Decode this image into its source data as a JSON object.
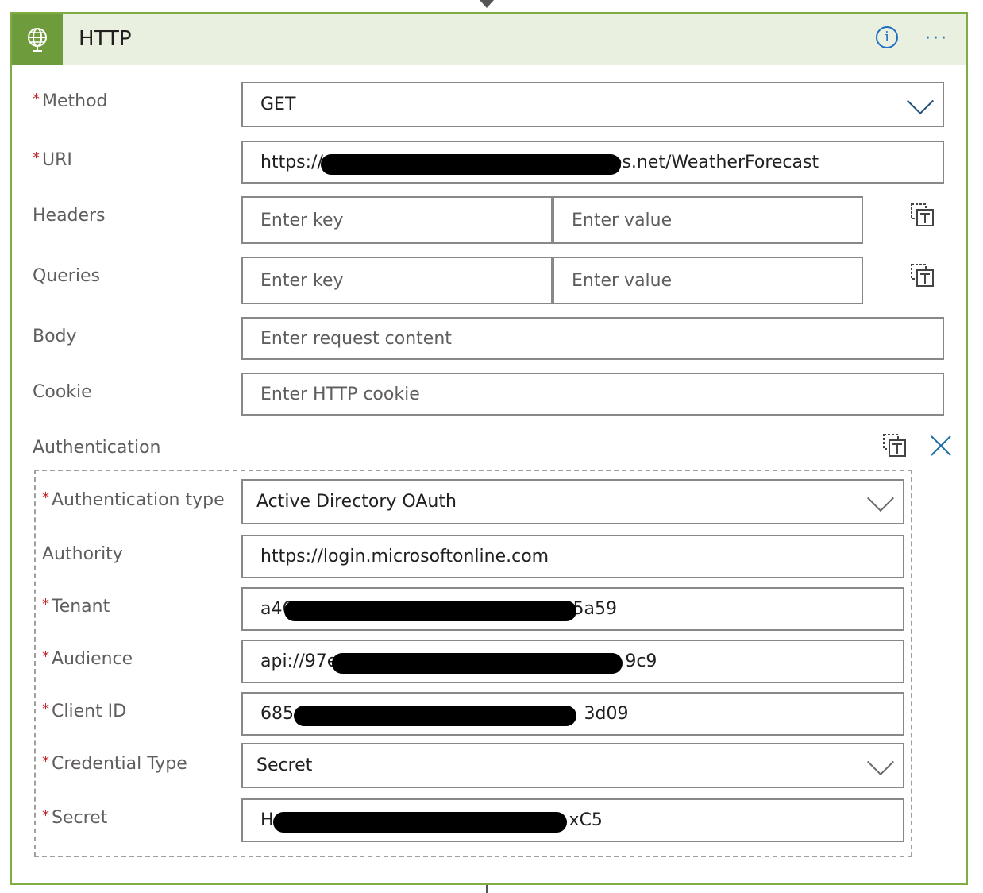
{
  "card": {
    "title": "HTTP",
    "info_label": "i",
    "more_label": "···"
  },
  "colors": {
    "accent_border": "#7fad43",
    "header_bg": "#e9f0e0",
    "icon_bg": "#6e9b3c",
    "link_blue": "#1f6fc5",
    "required_red": "#c4262e"
  },
  "required_marker": "*",
  "fields": {
    "method": {
      "label": "Method",
      "value": "GET"
    },
    "uri": {
      "label": "URI",
      "value_start": "https://",
      "value_end": "es.net/WeatherForecast"
    },
    "headers": {
      "label": "Headers",
      "key_placeholder": "Enter key",
      "value_placeholder": "Enter value"
    },
    "queries": {
      "label": "Queries",
      "key_placeholder": "Enter key",
      "value_placeholder": "Enter value"
    },
    "body": {
      "label": "Body",
      "placeholder": "Enter request content"
    },
    "cookie": {
      "label": "Cookie",
      "placeholder": "Enter HTTP cookie"
    }
  },
  "authentication": {
    "label": "Authentication",
    "auth_type": {
      "label": "Authentication type",
      "value": "Active Directory OAuth"
    },
    "authority": {
      "label": "Authority",
      "value": "https://login.microsoftonline.com"
    },
    "tenant": {
      "label": "Tenant",
      "value_start": "a46",
      "value_end": "5a59"
    },
    "audience": {
      "label": "Audience",
      "value_start": "api://97e",
      "value_end": "9c9"
    },
    "client_id": {
      "label": "Client ID",
      "value_start": "685e",
      "value_end": "3d09"
    },
    "credential_type": {
      "label": "Credential Type",
      "value": "Secret"
    },
    "secret": {
      "label": "Secret",
      "value_start": "H",
      "value_end": "xC5"
    }
  },
  "icons": {
    "header": "globe-icon",
    "info": "info-icon",
    "more": "more-icon",
    "copy": "text-mode-icon",
    "close": "close-icon",
    "dropdown": "chevron-down-icon"
  }
}
